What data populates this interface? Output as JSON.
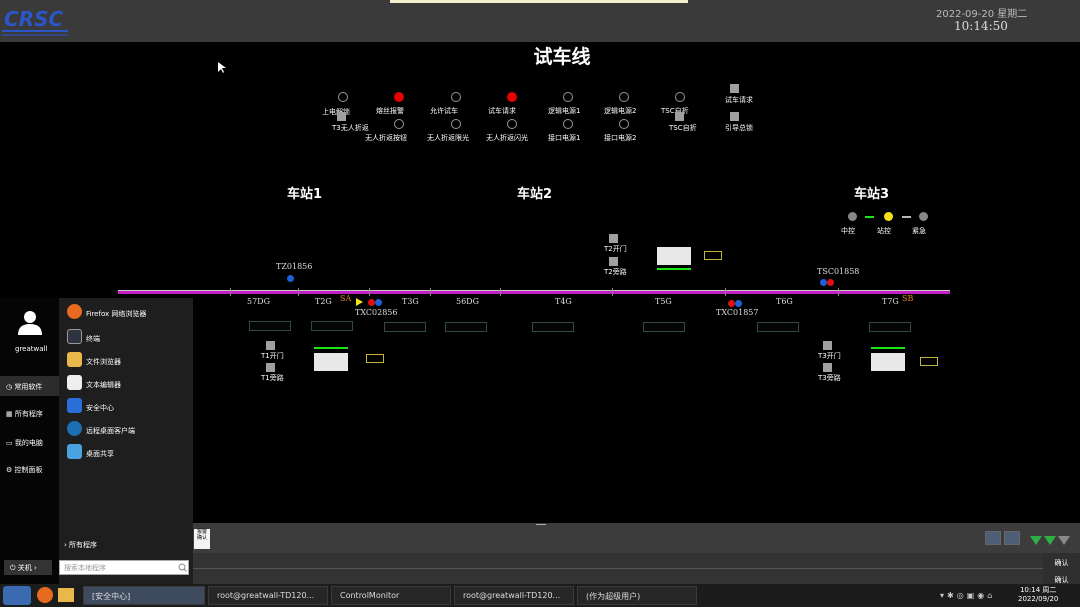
{
  "header": {
    "logo_text": "CRSC",
    "date": "2022-09-20 星期二",
    "time": "10:14:50"
  },
  "scene": {
    "title": "试车线"
  },
  "indicators": {
    "top_row": [
      "上电解锁",
      "熔丝报警",
      "允许试车",
      "试车请求",
      "逻辑电源1",
      "逻辑电源2",
      "TSC自折"
    ],
    "bottom_row": [
      "T3无人折返",
      "无人折返按钮",
      "无人折返限光",
      "无人折返闪光",
      "接口电源1",
      "接口电源2",
      "TSC自折"
    ],
    "right": [
      "试车请求",
      "引导总锁"
    ]
  },
  "stations": [
    "车站1",
    "车站2",
    "车站3"
  ],
  "station3_controls": [
    "中控",
    "站控",
    "紧急"
  ],
  "track": {
    "sections": [
      "57DG",
      "T2G",
      "T3G",
      "56DG",
      "T4G",
      "T5G",
      "T6G",
      "T7G"
    ],
    "signs": [
      "SA",
      "SB"
    ],
    "trains": [
      "TZ01856",
      "TXC02856",
      "TXC01857",
      "TSC01858"
    ],
    "gates": [
      "T1开门",
      "T1旁路",
      "T2开门",
      "T2旁路",
      "T3开门",
      "T3旁路"
    ]
  },
  "bottom": {
    "alarm_label": "报警\n确认",
    "confirm": [
      "确认",
      "确认"
    ]
  },
  "start_menu": {
    "username": "greatwall",
    "side": [
      "常用软件",
      "所有程序",
      "我的电脑",
      "控制面板"
    ],
    "apps": [
      "Firefox 网络浏览器",
      "终端",
      "文件浏览器",
      "文本编辑器",
      "安全中心",
      "远程桌面客户端",
      "桌面共享"
    ],
    "all_programs": "所有程序",
    "shutdown": "关机",
    "search_placeholder": "搜索本地程序"
  },
  "taskbar": {
    "tasks": [
      "[安全中心]",
      "root@greatwall-TD120...",
      "ControlMonitor",
      "root@greatwall-TD120...",
      "(作为超级用户)"
    ],
    "clock_time": "10:14 周二",
    "clock_date": "2022/09/20"
  }
}
